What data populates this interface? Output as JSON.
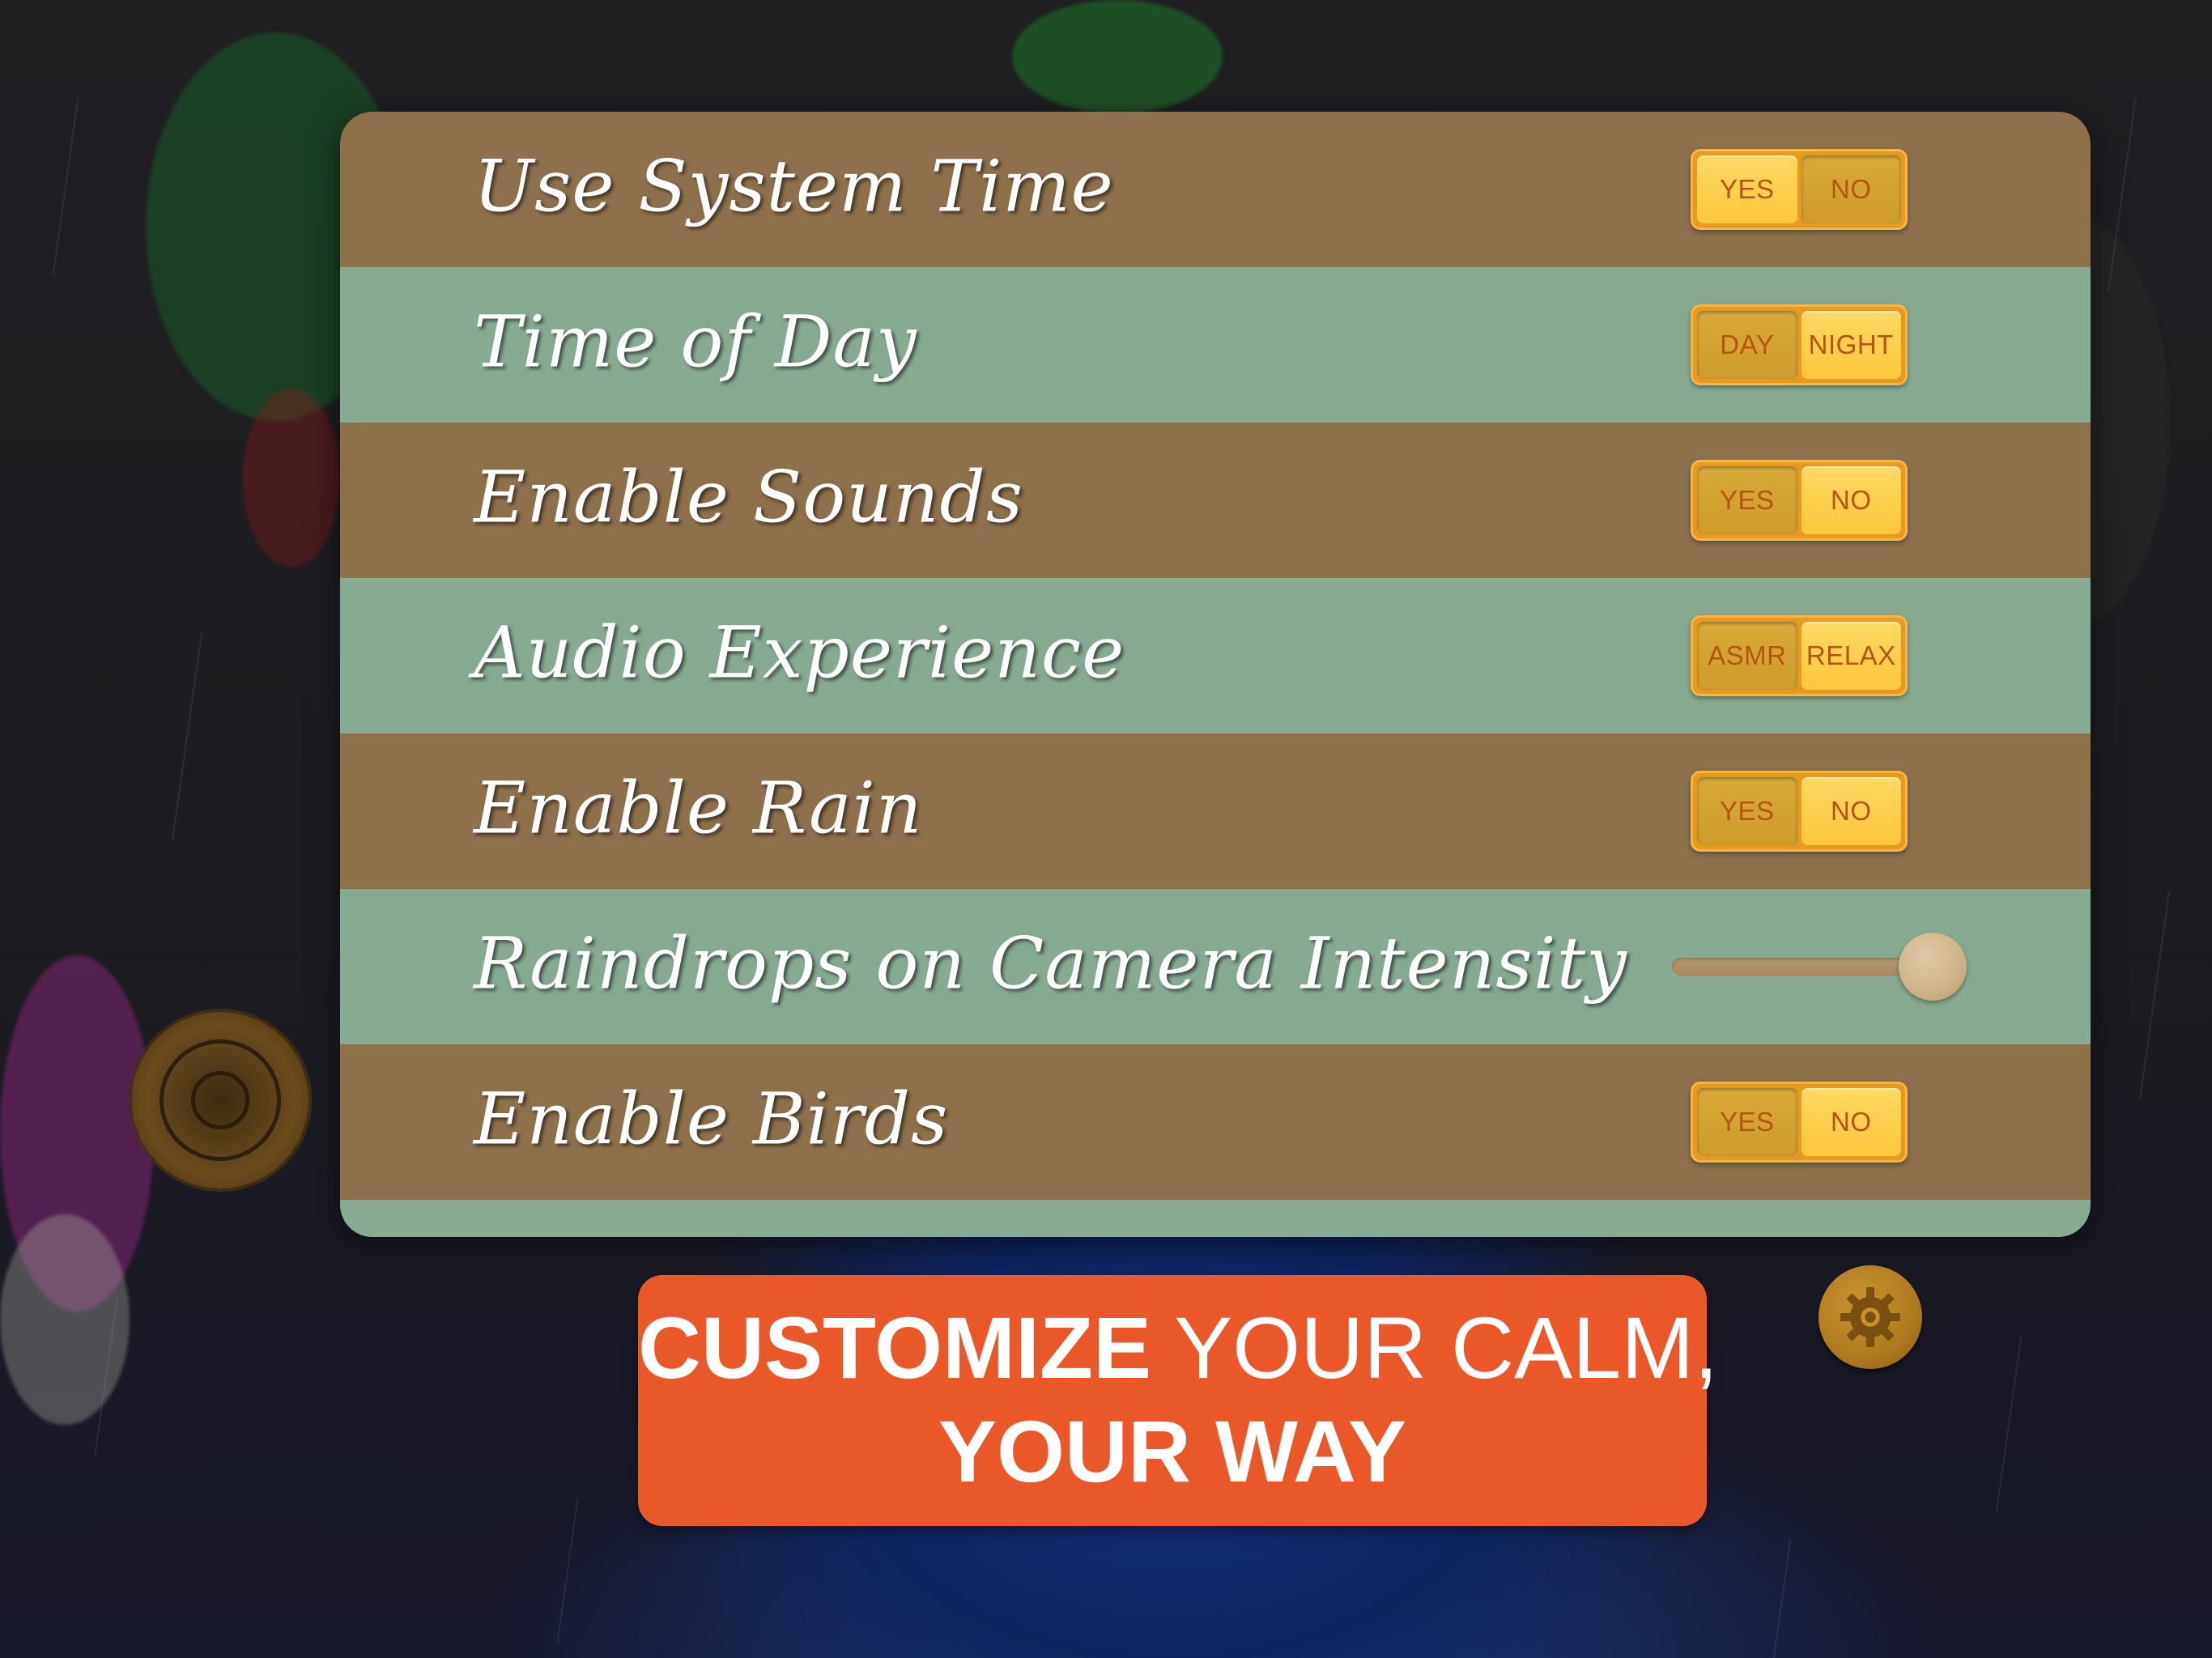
{
  "settings": {
    "rows": [
      {
        "label": "Use System Time",
        "control": "toggle",
        "options": [
          "YES",
          "NO"
        ],
        "selected": "YES"
      },
      {
        "label": "Time of Day",
        "control": "toggle",
        "options": [
          "DAY",
          "NIGHT"
        ],
        "selected": "NIGHT"
      },
      {
        "label": "Enable Sounds",
        "control": "toggle",
        "options": [
          "YES",
          "NO"
        ],
        "selected": "NO"
      },
      {
        "label": "Audio Experience",
        "control": "toggle",
        "options": [
          "ASMR",
          "RELAX"
        ],
        "selected": "RELAX"
      },
      {
        "label": "Enable Rain",
        "control": "toggle",
        "options": [
          "YES",
          "NO"
        ],
        "selected": "NO"
      },
      {
        "label": "Raindrops on Camera Intensity",
        "control": "slider",
        "value": 1.0
      },
      {
        "label": "Enable Birds",
        "control": "toggle",
        "options": [
          "YES",
          "NO"
        ],
        "selected": "NO"
      }
    ]
  },
  "cta": {
    "line1_bold": "CUSTOMIZE",
    "line1_light": " YOUR CALM,",
    "line2": "YOUR WAY"
  },
  "icons": {
    "joystick": "joystick-icon",
    "gear": "gear-icon"
  },
  "colors": {
    "row_brown": "#8d714d",
    "row_green": "#88aa92",
    "toggle_on": "#ffc73b",
    "toggle_off": "#cf9c2d",
    "toggle_text": "#b5540f",
    "cta_background": "#ea5728"
  }
}
